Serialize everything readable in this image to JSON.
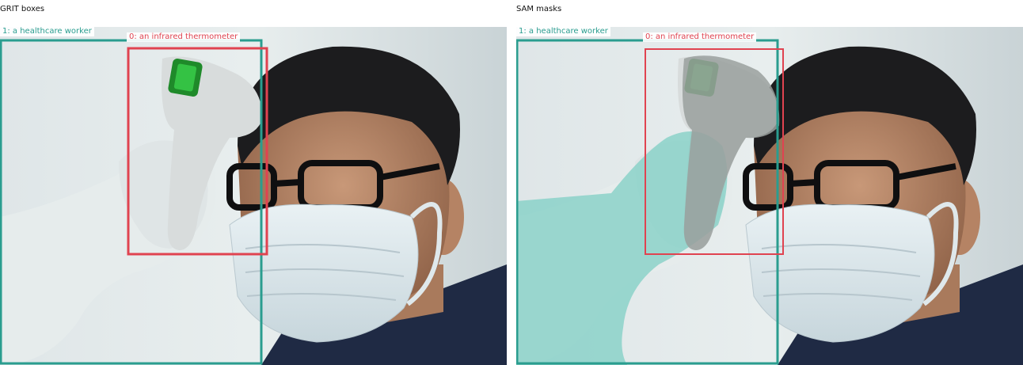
{
  "panels": {
    "left": {
      "title": "GRIT boxes",
      "label_worker": "1: a healthcare worker",
      "label_thermo": "0: an infrared thermometer"
    },
    "right": {
      "title": "SAM masks",
      "label_worker": "1: a healthcare worker",
      "label_thermo": "0: an infrared thermometer"
    }
  },
  "colors": {
    "worker_box": "#2a9d8f",
    "thermo_box": "#e04350",
    "worker_mask": "#7fcfc4",
    "thermo_mask": "#9aa09e"
  }
}
